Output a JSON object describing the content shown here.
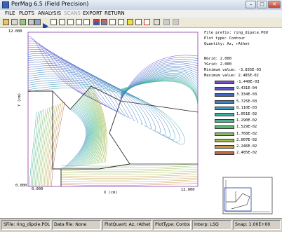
{
  "window": {
    "title": "PerMag 6.5 (Field Precision)"
  },
  "menu": [
    {
      "label": "FILE",
      "enabled": true
    },
    {
      "label": "PLOTS",
      "enabled": true
    },
    {
      "label": "ANALYSIS",
      "enabled": true
    },
    {
      "label": "SCANS",
      "enabled": false
    },
    {
      "label": "EXPORT",
      "enabled": true
    },
    {
      "label": "RETURN",
      "enabled": true
    }
  ],
  "toolbar_icons": [
    "open-folder-icon",
    "print-icon",
    "refresh-icon",
    "plot-options-icon",
    "calculator-icon",
    "run-icon",
    "zoom-icon",
    "zoom-in-icon",
    "zoom-out-icon",
    "grid-icon",
    "mesh-icon",
    "contour-icon",
    "filled-contour-icon",
    "element-plot-icon",
    "region-icon",
    "scan-line-icon",
    "vector-icon",
    "reset-icon",
    "select-icon",
    "erase-icon",
    "disabled-icon"
  ],
  "plot_info": {
    "file_prefix": "File prefix: ring_dipole.POU",
    "plot_type": "Plot type: Contour",
    "quantity": "Quantity: Az, rAthet",
    "ngrid": "NGrid:      2.000",
    "ygrid": "YGrid:      2.000",
    "minimum": "Minimum value:  -3.835E-03",
    "maximum": "Maximum value:   2.485E-02"
  },
  "legend": [
    {
      "color": "#7b4fc6",
      "label": "-1.440E-03"
    },
    {
      "color": "#5b53c9",
      "label": "9.431E-04"
    },
    {
      "color": "#3e66c6",
      "label": "3.334E-03"
    },
    {
      "color": "#3b80c2",
      "label": "5.725E-03"
    },
    {
      "color": "#3b9ab8",
      "label": "8.110E-03"
    },
    {
      "color": "#3eaea8",
      "label": "1.051E-02"
    },
    {
      "color": "#44b58d",
      "label": "1.290E-02"
    },
    {
      "color": "#59b870",
      "label": "1.529E-02"
    },
    {
      "color": "#7dbb55",
      "label": "1.768E-02"
    },
    {
      "color": "#a2b946",
      "label": "2.007E-02"
    },
    {
      "color": "#c39843",
      "label": "2.246E-02"
    },
    {
      "color": "#c06846",
      "label": "2.485E-02"
    }
  ],
  "axes": {
    "x_min": "0.000",
    "x_max": "12.000",
    "y_min": "0.000",
    "y_max": "12.000",
    "x_label": "X (cm)",
    "y_label": "Y (cm)"
  },
  "status": {
    "sfile": "SFile: ring_dipole.POU",
    "data_file": "Data file: None",
    "plot_quant": "PlotQuant: Az, rAthet",
    "plot_type": "PlotType: Contour",
    "interp": "Interp: LSQ",
    "snap": "Snap:  1.00E+00"
  },
  "colors": {
    "boundary": "#2b2b2b",
    "contour_low": "#7b4fc6",
    "contour_high": "#c06846"
  }
}
